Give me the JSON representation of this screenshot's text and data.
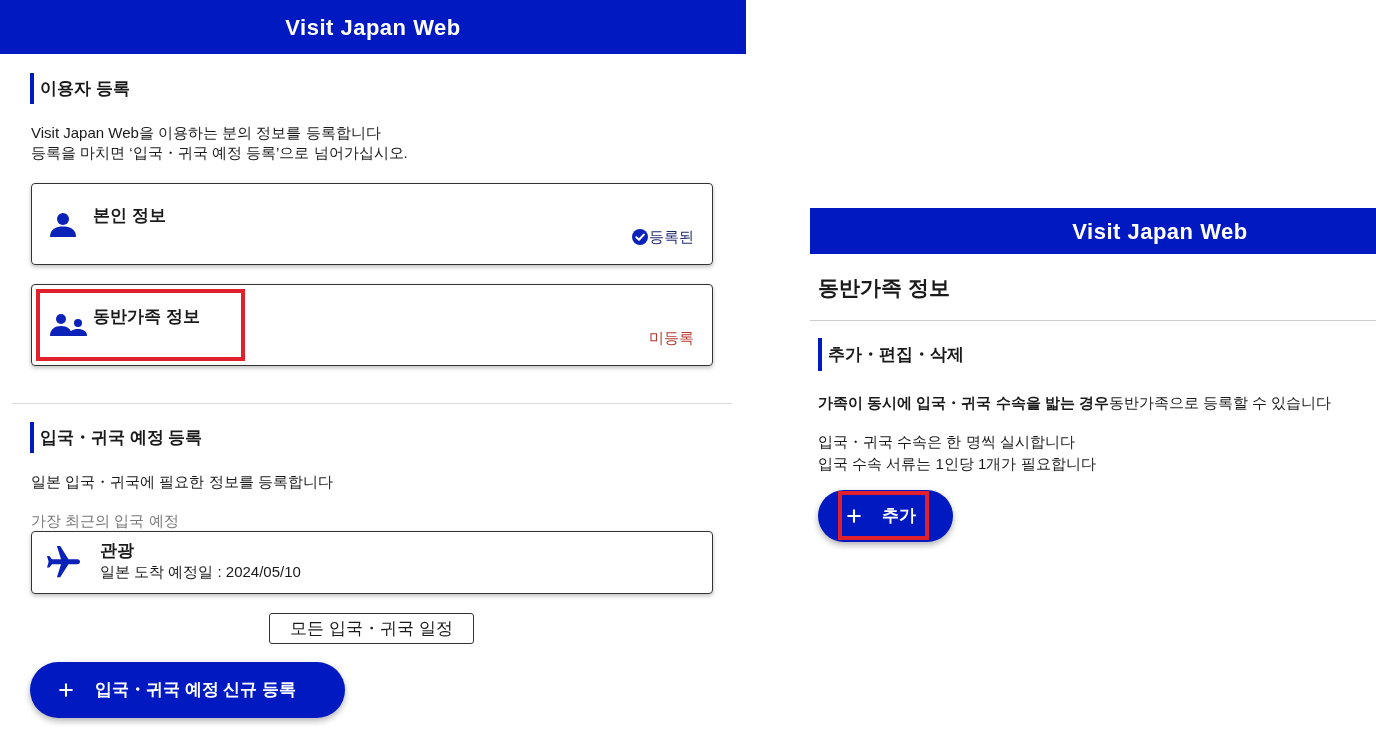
{
  "registration_screen": {
    "header": {
      "title": "Visit Japan Web"
    },
    "user_section": {
      "heading": "이용자 등록",
      "description": [
        "Visit Japan Web을 이용하는 분의 정보를 등록합니다",
        "등록을 마치면 ‘입국・귀국 예정 등록’으로 넘어가십시오."
      ],
      "cards": [
        {
          "kind": "self",
          "title": "본인 정보",
          "status": {
            "kind": "registered",
            "label": "등록된"
          },
          "highlighted": false
        },
        {
          "kind": "family",
          "title": "동반가족 정보",
          "status": {
            "kind": "unregistered",
            "label": "미등록"
          },
          "highlighted": true
        }
      ]
    },
    "trip_section": {
      "heading": "입국・귀국 예정 등록",
      "description": "일본 입국・귀국에 필요한 정보를 등록합니다",
      "latest_label": "가장 최근의 입국 예정",
      "trip": {
        "title": "관광",
        "arrival": "일본 도착 예정일 : 2024/05/10"
      },
      "all_trips_button": "모든 입국・귀국 일정",
      "new_button": "입국・귀국 예정 신규 등록"
    }
  },
  "family_screen": {
    "header": {
      "title": "Visit Japan Web"
    },
    "title": "동반가족 정보",
    "section": {
      "heading": "추가・편집・삭제",
      "description": "**가족이 동시에 입국・귀국 수속을 밟는 경우**동반가족으로 등록할 수 있습니다",
      "notes": [
        "입국・귀국 수속은 한 명씩 실시합니다",
        "입국 수속 서류는 1인당 1개가 필요합니다"
      ],
      "add_button": {
        "label": "추가",
        "highlighted": true
      }
    }
  }
}
